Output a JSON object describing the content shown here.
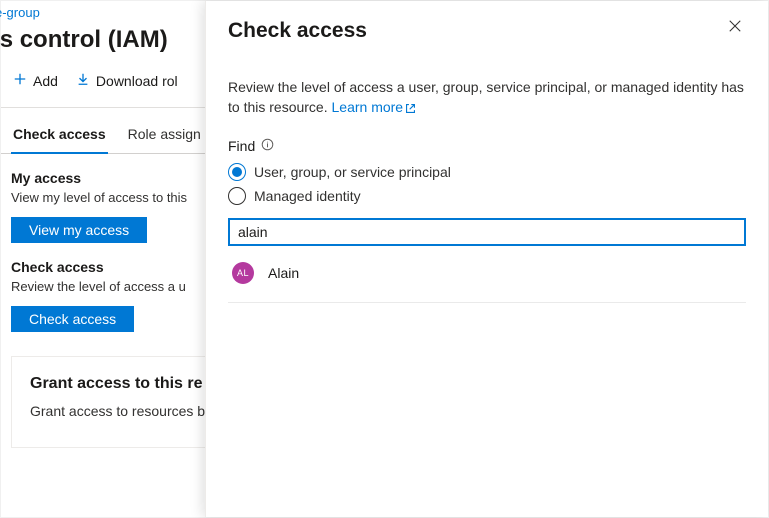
{
  "page": {
    "breadcrumb": "e-group",
    "title": "ess control (IAM)",
    "toolbar": {
      "add": "Add",
      "download": "Download rol"
    },
    "tabs": {
      "check_access": "Check access",
      "role_assignments": "Role assign"
    },
    "my_access": {
      "title": "My access",
      "desc": "View my level of access to this",
      "button": "View my access"
    },
    "check_access": {
      "title": "Check access",
      "desc": "Review the level of access a u",
      "button": "Check access"
    },
    "grant": {
      "title": "Grant access to this re",
      "desc": "Grant access to resources b"
    }
  },
  "flyout": {
    "title": "Check access",
    "intro_text": "Review the level of access a user, group, service principal, or managed identity has to this resource. ",
    "learn_more": "Learn more",
    "find_label": "Find",
    "radio_user": "User, group, or service principal",
    "radio_mi": "Managed identity",
    "search_value": "alain",
    "result": {
      "initials": "AL",
      "name": "Alain"
    }
  }
}
